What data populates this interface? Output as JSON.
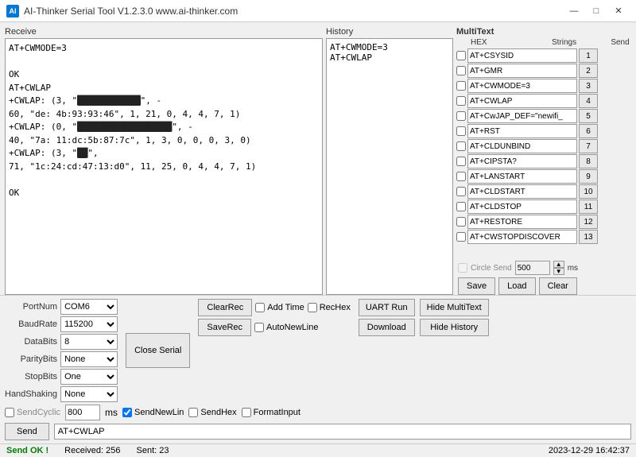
{
  "titlebar": {
    "title": "AI-Thinker Serial Tool V1.2.3.0   www.ai-thinker.com",
    "icon_label": "AI",
    "min_btn": "—",
    "max_btn": "□",
    "close_btn": "✕"
  },
  "receive": {
    "label": "Receive",
    "content_lines": [
      "AT+CWMODE=3",
      "",
      "OK",
      "AT+CWLAP",
      "+CWLAP: (3, \"██████████████\", -",
      "60, \"de: 4b:93:93:46\", 1, 21, 0, 4, 4, 7, 1)",
      "+CWLAP: (0, \"████████████████████\", -",
      "40, \"7a: 11:dc:5b:87:7c\", 1, 3, 0, 0, 0, 3, 0)",
      "+CWLAP: (3, \"████\",",
      "71, \"1c:24:cd:47:13:d0\", 11, 25, 0, 4, 4, 7, 1)",
      "",
      "OK"
    ]
  },
  "history": {
    "label": "History",
    "items": [
      "AT+CWMODE=3",
      "AT+CWLAP"
    ]
  },
  "multitext": {
    "title": "MultiText",
    "col_hex": "HEX",
    "col_strings": "Strings",
    "col_send": "Send",
    "rows": [
      {
        "checked": false,
        "value": "AT+CSYSID",
        "num": "1"
      },
      {
        "checked": false,
        "value": "AT+GMR",
        "num": "2"
      },
      {
        "checked": false,
        "value": "AT+CWMODE=3",
        "num": "3"
      },
      {
        "checked": false,
        "value": "AT+CWLAP",
        "num": "4"
      },
      {
        "checked": false,
        "value": "AT+CwJAP_DEF=\"newifi_",
        "num": "5"
      },
      {
        "checked": false,
        "value": "AT+RST",
        "num": "6"
      },
      {
        "checked": false,
        "value": "AT+CLDUNBIND",
        "num": "7"
      },
      {
        "checked": false,
        "value": "AT+CIPSTA?",
        "num": "8"
      },
      {
        "checked": false,
        "value": "AT+LANSTART",
        "num": "9"
      },
      {
        "checked": false,
        "value": "AT+CLDSTART",
        "num": "10"
      },
      {
        "checked": false,
        "value": "AT+CLDSTOP",
        "num": "11"
      },
      {
        "checked": false,
        "value": "AT+RESTORE",
        "num": "12"
      },
      {
        "checked": false,
        "value": "AT+CWSTOPDISCOVER",
        "num": "13"
      }
    ],
    "circle_send_label": "Circle Send",
    "circle_send_value": "500",
    "ms_label": "ms",
    "save_btn": "Save",
    "load_btn": "Load",
    "clear_btn": "Clear"
  },
  "controls": {
    "port_num_label": "PortNum",
    "port_num_value": "COM6",
    "baud_rate_label": "BaudRate",
    "baud_rate_value": "115200",
    "data_bits_label": "DataBits",
    "data_bits_value": "8",
    "parity_label": "ParityBits",
    "parity_value": "None",
    "stop_bits_label": "StopBits",
    "stop_bits_value": "One",
    "handshaking_label": "HandShaking",
    "handshaking_value": "None",
    "close_serial_btn": "Close Serial",
    "clear_rec_btn": "ClearRec",
    "save_rec_btn": "SaveRec",
    "add_time_label": "Add Time",
    "rec_hex_label": "RecHex",
    "auto_newline_label": "AutoNewLine",
    "uart_run_btn": "UART Run",
    "download_btn": "Download",
    "hide_multitext_btn": "Hide MultiText",
    "hide_history_btn": "Hide History",
    "send_cyclic_label": "SendCyclic",
    "send_cyclic_value": "800",
    "ms_label2": "ms",
    "send_newline_label": "SendNewLin",
    "send_newline_checked": true,
    "send_hex_label": "SendHex",
    "format_input_label": "FormatInput",
    "send_btn": "Send",
    "send_input_value": "AT+CWLAP"
  },
  "statusbar": {
    "send_ok": "Send OK !",
    "received_label": "Received:",
    "received_value": "256",
    "sent_label": "Sent:",
    "sent_value": "23",
    "datetime": "2023-12-29 16:42:37"
  }
}
